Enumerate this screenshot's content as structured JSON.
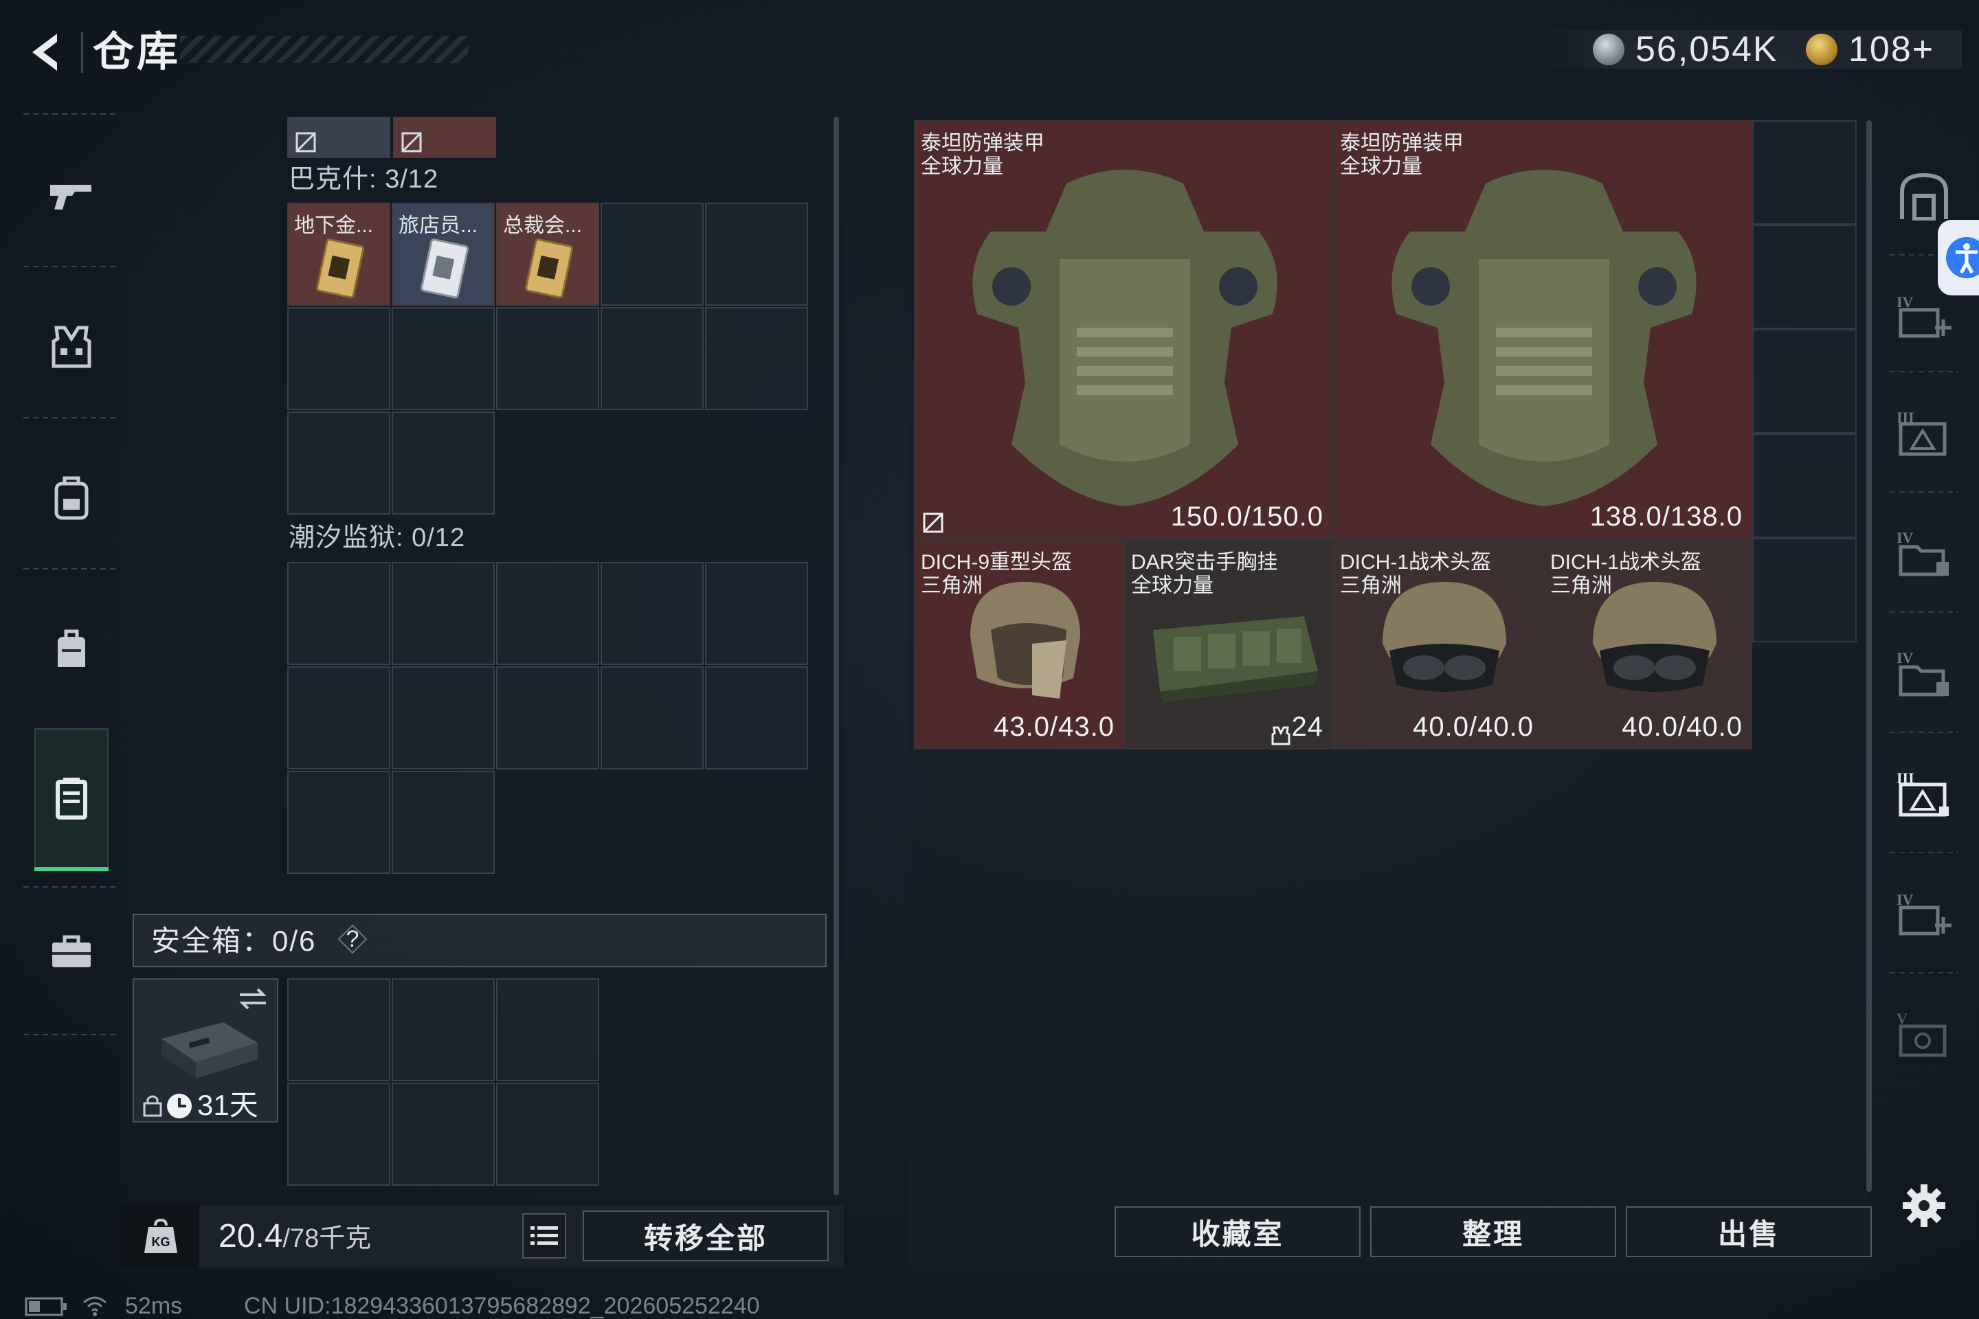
{
  "header": {
    "title": "仓库",
    "currency_1": "56,054K",
    "currency_2": "108+"
  },
  "left_nav": {
    "items": [
      "gun-icon",
      "vest-icon",
      "backpack-icon",
      "bag-icon",
      "locker-icon",
      "briefcase-icon"
    ],
    "active_index": 4
  },
  "containers": {
    "bakesh_label": "巴克什: 3/12",
    "bakesh_items": [
      {
        "label": "地下金...",
        "color": "#5a3838"
      },
      {
        "label": "旅店员...",
        "color": "#3b4458"
      },
      {
        "label": "总裁会...",
        "color": "#5a3838"
      }
    ],
    "tidal_label": "潮汐监狱: 0/12"
  },
  "safe_box": {
    "label": "安全箱：0/6",
    "help": "?",
    "days": "31天"
  },
  "bottom_left": {
    "weight_value": "20.4",
    "weight_max": "/78千克",
    "transfer_all": "转移全部"
  },
  "stash": {
    "items": [
      {
        "name": "泰坦防弹装甲",
        "sub": "全球力量",
        "durability": "150.0/150.0",
        "color": "#4e2a2c"
      },
      {
        "name": "泰坦防弹装甲",
        "sub": "全球力量",
        "durability": "138.0/138.0",
        "color": "#4e2a2c"
      },
      {
        "name": "DICH-9重型头盔",
        "sub": "三角洲",
        "durability": "43.0/43.0",
        "color": "#4e2a2c"
      },
      {
        "name": "DAR突击手胸挂",
        "sub": "全球力量",
        "durability": "24",
        "color": "#34302f"
      },
      {
        "name": "DICH-1战术头盔",
        "sub": "三角洲",
        "durability": "40.0/40.0",
        "color": "#3d3030"
      },
      {
        "name": "DICH-1战术头盔",
        "sub": "三角洲",
        "durability": "40.0/40.0",
        "color": "#3d3030"
      }
    ]
  },
  "bottom_right": {
    "collection": "收藏室",
    "sort": "整理",
    "sell": "出售"
  },
  "right_nav": {
    "items": [
      "vault-icon",
      "stash-IV-add-icon",
      "stash-III-icon",
      "stash-IV-folder-icon",
      "stash-IV-folder-icon-2",
      "stash-III-active-icon",
      "stash-IV-add-icon-2",
      "stash-V-icon"
    ]
  },
  "status": {
    "ping": "52ms",
    "uid": "CN UID:18294336013795682892_202605252240"
  },
  "colors": {
    "accent_green": "#3fd08a",
    "item_red": "#4e2a2c",
    "accessibility_blue": "#2f7cf6"
  }
}
